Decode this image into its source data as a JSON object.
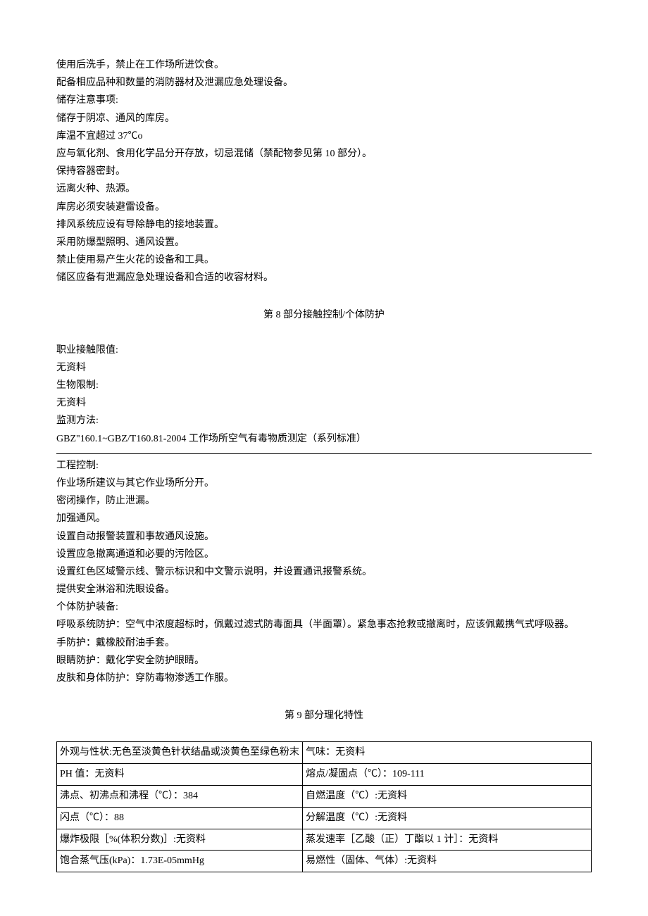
{
  "intro_lines": [
    "使用后洗手，禁止在工作场所进饮食。",
    "配备相应品种和数量的消防器材及泄漏应急处理设备。",
    "储存注意事项:",
    "储存于阴凉、通风的库房。",
    "库温不宜超过 37℃o",
    "应与氧化剂、食用化学品分开存放，切忌混储（禁配物参见第 10 部分）。",
    "保持容器密封。",
    "远离火种、热源。",
    "库房必须安装避雷设备。",
    "排风系统应设有导除静电的接地装置。",
    "采用防爆型照明、通风设置。",
    "禁止使用易产生火花的设备和工具。",
    "储区应备有泄漏应急处理设备和合适的收容材料。"
  ],
  "section8": {
    "heading": "第 8 部分接触控制/个体防护",
    "upper_lines": [
      "职业接触限值:",
      "无资料",
      "生物限制:",
      "无资料",
      "监测方法:",
      "GBZ\"160.1~GBZ/T160.81-2004 工作场所空气有毒物质测定（系列标准）"
    ],
    "lower_lines": [
      "工程控制:",
      "作业场所建议与其它作业场所分开。",
      "密闭操作，防止泄漏。",
      "加强通风。",
      "设置自动报警装置和事故通风设施。",
      "设置应急撤离通道和必要的污险区。",
      "设置红色区域警示线、警示标识和中文警示说明，并设置通讯报警系统。",
      "提供安全淋浴和洗眼设备。",
      "个体防护装备:",
      "呼吸系统防护：空气中浓度超标时，佩戴过滤式防毒面具（半面罩）。紧急事态抢救或撤离时，应该佩戴携气式呼吸器。",
      "手防护：戴橡胶耐油手套。",
      "眼睛防护：戴化学安全防护眼睛。",
      "皮肤和身体防护：穿防毒物渗透工作服。"
    ]
  },
  "section9": {
    "heading": "第 9 部分理化特性",
    "rows": [
      {
        "left": "外观与性状:无色至淡黄色针状结晶或淡黄色至绿色粉末",
        "right": "气味：无资料"
      },
      {
        "left": "PH 值：无资料",
        "right": "熔点/凝固点（℃）：109-111"
      },
      {
        "left": "沸点、初沸点和沸程（℃）：384",
        "right": "自燃温度（℃）:无资料"
      },
      {
        "left": "闪点（℃）：88",
        "right": "分解温度（℃）:无资料"
      },
      {
        "left": "爆炸极限［%(体积分数)］:无资料",
        "right": "蒸发速率［乙酸（正）丁酯以 1 计］：无资料"
      },
      {
        "left": "饱合蒸气压(kPa)：1.73E-05mmHg",
        "right": "易燃性（固体、气体）:无资料"
      }
    ]
  }
}
